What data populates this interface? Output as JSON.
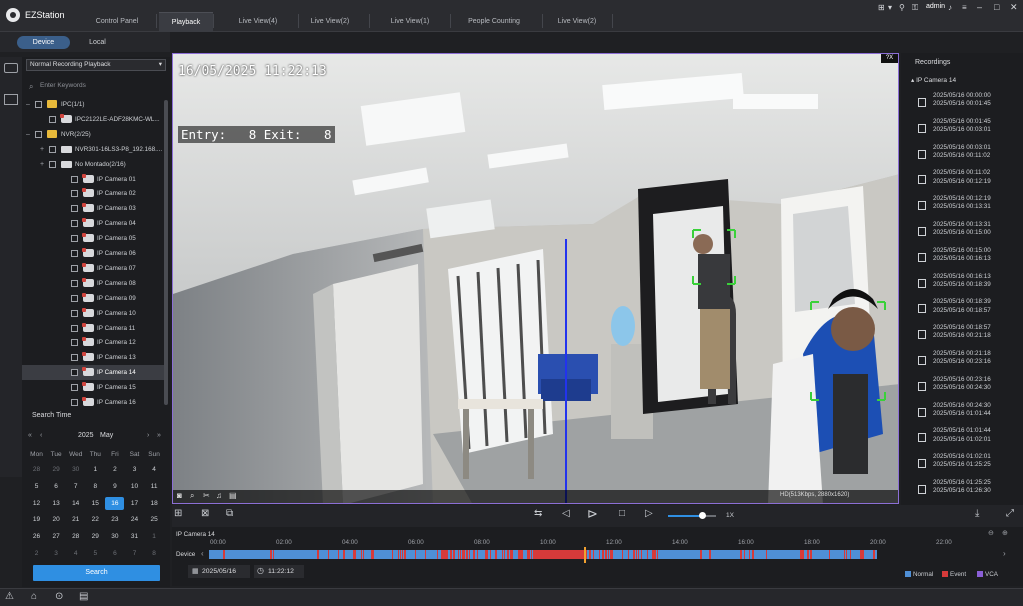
{
  "app": {
    "title": "EZStation",
    "user": "admin"
  },
  "tabs": [
    {
      "label": "Control Panel",
      "active": false
    },
    {
      "label": "Playback",
      "active": true
    },
    {
      "label": "Live View(4)",
      "active": false
    },
    {
      "label": "Live View(2)",
      "active": false
    },
    {
      "label": "Live View(1)",
      "active": false
    },
    {
      "label": "People Counting",
      "active": false
    },
    {
      "label": "Live View(2)",
      "active": false
    }
  ],
  "left": {
    "subtabs": [
      "Device",
      "Local"
    ],
    "mode": "Normal Recording Playback",
    "search_placeholder": "Enter Keywords",
    "tree": [
      {
        "label": "IPC(1/1)",
        "kind": "folder",
        "level": 0
      },
      {
        "label": "IPC2122LE-ADF28KMC-WL...",
        "kind": "camera",
        "level": 1
      },
      {
        "label": "NVR(2/25)",
        "kind": "folder",
        "level": 0
      },
      {
        "label": "NVR301-16LS3-P8_192.168....",
        "kind": "nvr",
        "level": 1
      },
      {
        "label": "No Montado(2/16)",
        "kind": "nvr",
        "level": 1
      },
      {
        "label": "IP Camera 01",
        "kind": "camera",
        "level": 2
      },
      {
        "label": "IP Camera 02",
        "kind": "camera",
        "level": 2
      },
      {
        "label": "IP Camera 03",
        "kind": "camera",
        "level": 2
      },
      {
        "label": "IP Camera 04",
        "kind": "camera",
        "level": 2
      },
      {
        "label": "IP Camera 05",
        "kind": "camera",
        "level": 2
      },
      {
        "label": "IP Camera 06",
        "kind": "camera",
        "level": 2
      },
      {
        "label": "IP Camera 07",
        "kind": "camera",
        "level": 2
      },
      {
        "label": "IP Camera 08",
        "kind": "camera",
        "level": 2
      },
      {
        "label": "IP Camera 09",
        "kind": "camera",
        "level": 2
      },
      {
        "label": "IP Camera 10",
        "kind": "camera",
        "level": 2
      },
      {
        "label": "IP Camera 11",
        "kind": "camera",
        "level": 2
      },
      {
        "label": "IP Camera 12",
        "kind": "camera",
        "level": 2
      },
      {
        "label": "IP Camera 13",
        "kind": "camera",
        "level": 2
      },
      {
        "label": "IP Camera 14",
        "kind": "camera",
        "level": 2,
        "selected": true
      },
      {
        "label": "IP Camera 15",
        "kind": "camera",
        "level": 2
      },
      {
        "label": "IP Camera 16",
        "kind": "camera",
        "level": 2
      }
    ],
    "search_time_label": "Search Time",
    "calendar": {
      "nav_prev2": "«",
      "nav_prev": "‹",
      "year": "2025",
      "month": "May",
      "nav_next": "›",
      "nav_next2": "»",
      "weekdays": [
        "Mon",
        "Tue",
        "Wed",
        "Thu",
        "Fri",
        "Sat",
        "Sun"
      ],
      "days": [
        [
          "28",
          "29",
          "30",
          "1",
          "2",
          "3",
          "4"
        ],
        [
          "5",
          "6",
          "7",
          "8",
          "9",
          "10",
          "11"
        ],
        [
          "12",
          "13",
          "14",
          "15",
          "16",
          "17",
          "18"
        ],
        [
          "19",
          "20",
          "21",
          "22",
          "23",
          "24",
          "25"
        ],
        [
          "26",
          "27",
          "28",
          "29",
          "30",
          "31",
          "1"
        ],
        [
          "2",
          "3",
          "4",
          "5",
          "6",
          "7",
          "8"
        ]
      ],
      "selected": "16"
    },
    "search_button": "Search"
  },
  "video": {
    "timestamp": "16/05/2025 11:22:13",
    "counter": "Entry:   8 Exit:   8",
    "info": "HD(513Kbps, 2880x1620)",
    "close": "?X"
  },
  "controls": {
    "speed": "1X",
    "speed_fraction": 0.7
  },
  "timeline": {
    "camera": "IP Camera 14",
    "row_label": "Device",
    "ticks": [
      "00:00",
      "02:00",
      "04:00",
      "06:00",
      "08:00",
      "10:00",
      "12:00",
      "14:00",
      "16:00",
      "18:00",
      "20:00",
      "22:00"
    ],
    "date": "2025/05/16",
    "time": "11:22:12",
    "legend": [
      {
        "label": "Normal",
        "color": "#4f8fd6"
      },
      {
        "label": "Event",
        "color": "#d63a3a"
      },
      {
        "label": "VCA",
        "color": "#8a5fd6"
      }
    ]
  },
  "recordings": {
    "title": "Recordings",
    "camera": "IP Camera 14",
    "items": [
      [
        "2025/05/16  00:00:00",
        "2025/05/16  00:01:45"
      ],
      [
        "2025/05/16  00:01:45",
        "2025/05/16  00:03:01"
      ],
      [
        "2025/05/16  00:03:01",
        "2025/05/16  00:11:02"
      ],
      [
        "2025/05/16  00:11:02",
        "2025/05/16  00:12:19"
      ],
      [
        "2025/05/16  00:12:19",
        "2025/05/16  00:13:31"
      ],
      [
        "2025/05/16  00:13:31",
        "2025/05/16  00:15:00"
      ],
      [
        "2025/05/16  00:15:00",
        "2025/05/16  00:16:13"
      ],
      [
        "2025/05/16  00:16:13",
        "2025/05/16  00:18:39"
      ],
      [
        "2025/05/16  00:18:39",
        "2025/05/16  00:18:57"
      ],
      [
        "2025/05/16  00:18:57",
        "2025/05/16  00:21:18"
      ],
      [
        "2025/05/16  00:21:18",
        "2025/05/16  00:23:16"
      ],
      [
        "2025/05/16  00:23:16",
        "2025/05/16  00:24:30"
      ],
      [
        "2025/05/16  00:24:30",
        "2025/05/16  01:01:44"
      ],
      [
        "2025/05/16  01:01:44",
        "2025/05/16  01:02:01"
      ],
      [
        "2025/05/16  01:02:01",
        "2025/05/16  01:25:25"
      ],
      [
        "2025/05/16  01:25:25",
        "2025/05/16  01:26:30"
      ]
    ]
  }
}
